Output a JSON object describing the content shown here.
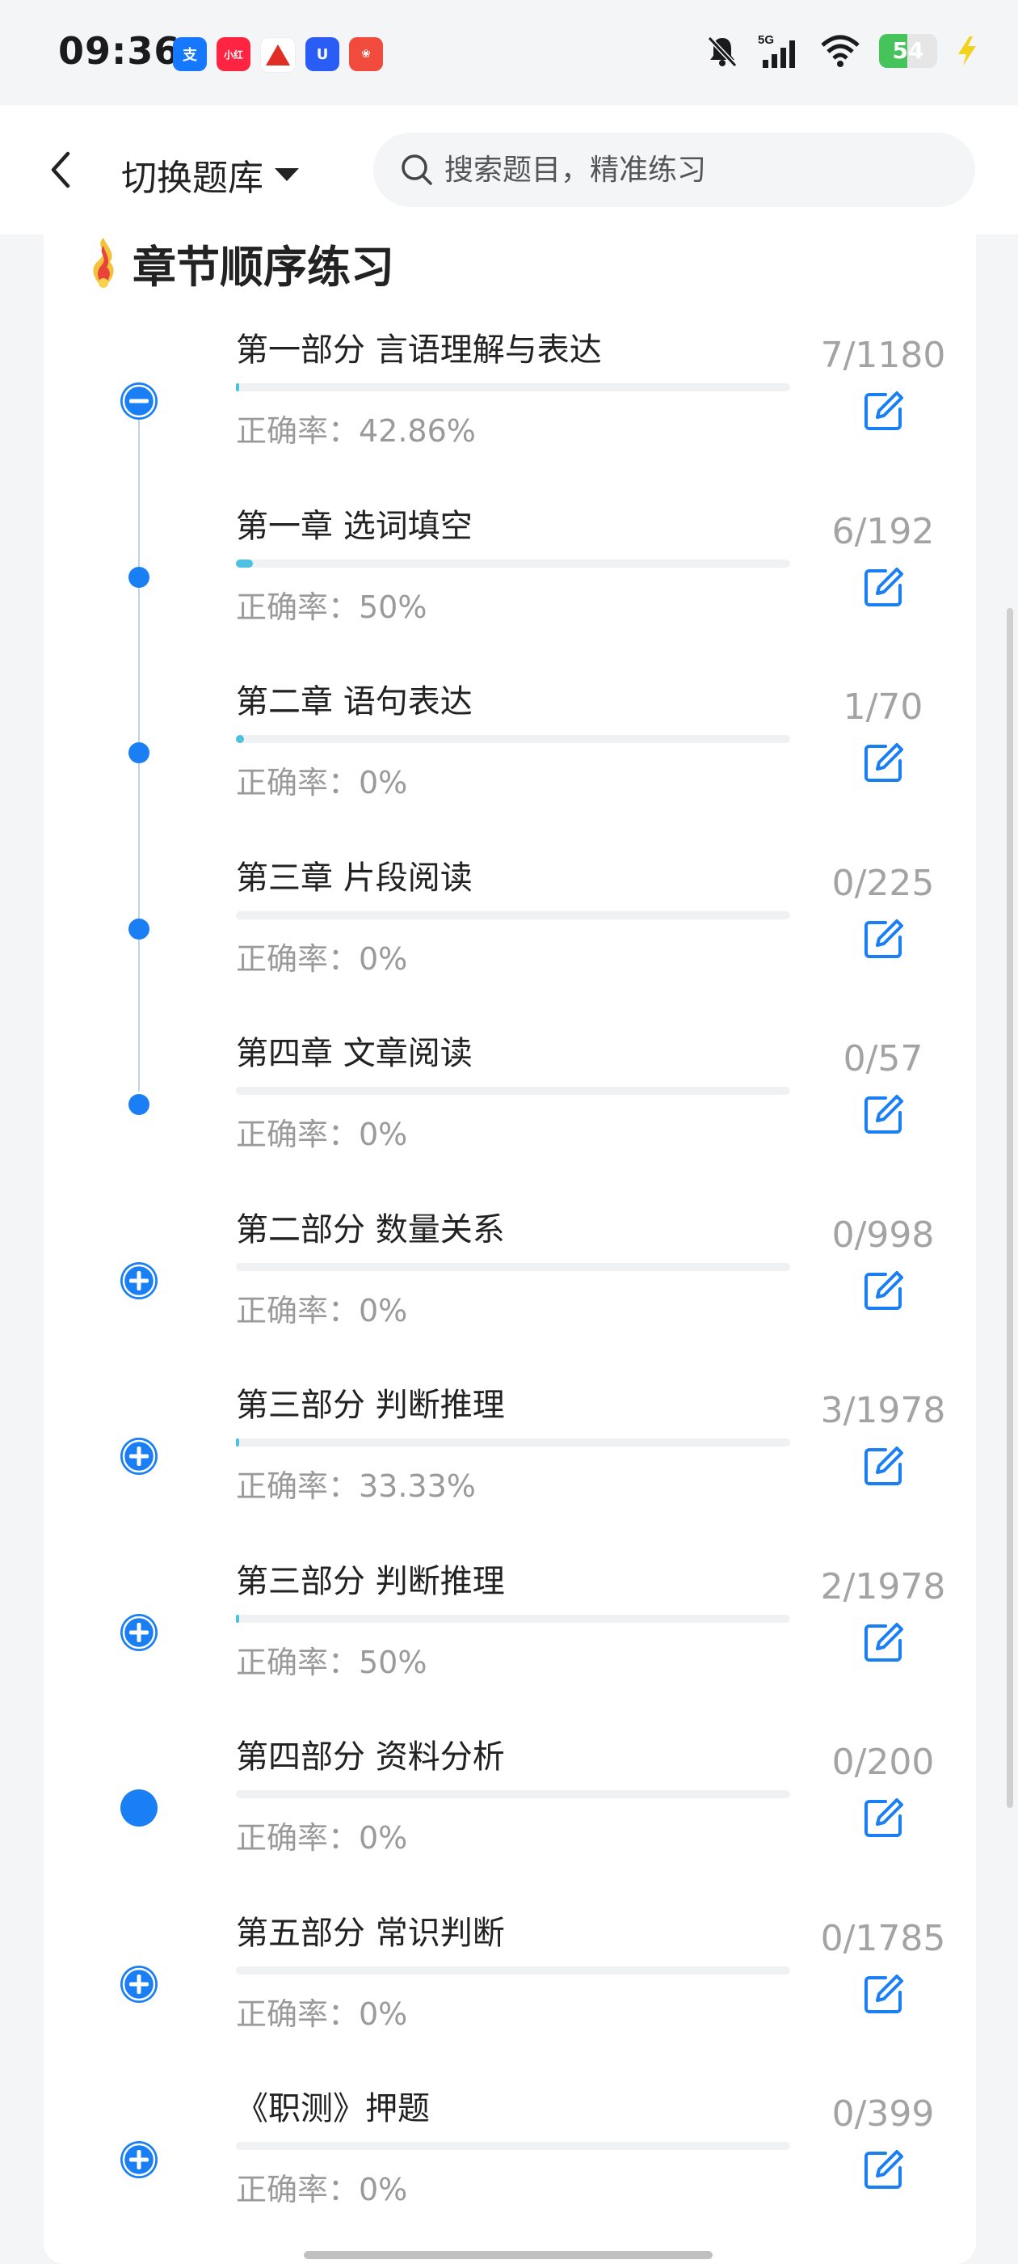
{
  "status_bar": {
    "time": "09:36",
    "notification_apps": [
      "alipay",
      "xiaohongshu",
      "pdd",
      "tmall",
      "taobao"
    ],
    "network": "5G",
    "battery": "54",
    "battery_percent": 54
  },
  "header": {
    "switch_bank_label": "切换题库",
    "search_placeholder": "搜索题目，精准练习"
  },
  "section": {
    "title": "章节顺序练习"
  },
  "accuracy_prefix": "正确率：",
  "items": [
    {
      "title": "第一部分 言语理解与表达",
      "accuracy": "正确率：42.86%",
      "count": "7/1180",
      "progress": 0.006,
      "node": "collapse"
    },
    {
      "title": "第一章 选词填空",
      "accuracy": "正确率：50%",
      "count": "6/192",
      "progress": 0.031,
      "node": "dot"
    },
    {
      "title": "第二章 语句表达",
      "accuracy": "正确率：0%",
      "count": "1/70",
      "progress": 0.014,
      "node": "dot"
    },
    {
      "title": "第三章 片段阅读",
      "accuracy": "正确率：0%",
      "count": "0/225",
      "progress": 0,
      "node": "dot"
    },
    {
      "title": "第四章 文章阅读",
      "accuracy": "正确率：0%",
      "count": "0/57",
      "progress": 0,
      "node": "dot"
    },
    {
      "title": "第二部分 数量关系",
      "accuracy": "正确率：0%",
      "count": "0/998",
      "progress": 0,
      "node": "expand"
    },
    {
      "title": "第三部分 判断推理",
      "accuracy": "正确率：33.33%",
      "count": "3/1978",
      "progress": 0.0015,
      "node": "expand"
    },
    {
      "title": "第三部分 判断推理",
      "accuracy": "正确率：50%",
      "count": "2/1978",
      "progress": 0.001,
      "node": "expand"
    },
    {
      "title": "第四部分 资料分析",
      "accuracy": "正确率：0%",
      "count": "0/200",
      "progress": 0,
      "node": "solid"
    },
    {
      "title": "第五部分 常识判断",
      "accuracy": "正确率：0%",
      "count": "0/1785",
      "progress": 0,
      "node": "expand"
    },
    {
      "title": "《职测》押题",
      "accuracy": "正确率：0%",
      "count": "0/399",
      "progress": 0,
      "node": "expand"
    }
  ],
  "colors": {
    "accent": "#1a7ff5",
    "progress": "#4fc1e0",
    "muted_text": "#9a9a9a"
  }
}
